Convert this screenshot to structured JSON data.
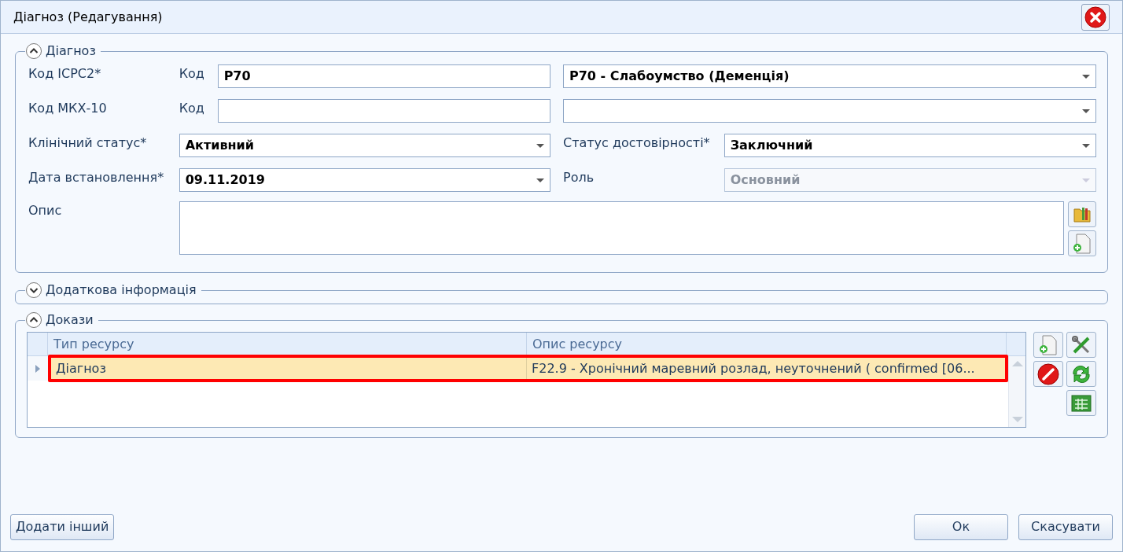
{
  "window": {
    "title": "Діагноз (Редагування)"
  },
  "diagnosis": {
    "title": "Діагноз",
    "expanded": true,
    "icpc2": {
      "label": "Код ICPC2*",
      "code_label": "Код",
      "code": "P70",
      "name": "P70 - Слабоумство (Деменція)"
    },
    "mkx10": {
      "label": "Код МКХ-10",
      "code_label": "Код"
    },
    "clinical_status": {
      "label": "Клінічний статус*",
      "value": "Активний"
    },
    "verification_status": {
      "label": "Статус достовірності*",
      "value": "Заключний"
    },
    "onset_date": {
      "label": "Дата встановлення*",
      "value": "09.11.2019"
    },
    "role": {
      "label": "Роль",
      "value": "Основний",
      "disabled": true
    },
    "description": {
      "label": "Опис"
    }
  },
  "additional_info": {
    "title": "Додаткова інформація",
    "expanded": false
  },
  "evidence": {
    "title": "Докази",
    "expanded": true,
    "columns": [
      "Тип ресурсу",
      "Опис ресурсу"
    ],
    "rows": [
      {
        "cells": [
          "Діагноз",
          "F22.9 - Хронічний маревний розлад, неуточнений ( confirmed [06..."
        ],
        "selected": true,
        "highlighted": true
      }
    ]
  },
  "buttons": {
    "add_another": "Додати інший",
    "ok": "Ок",
    "cancel": "Скасувати"
  }
}
